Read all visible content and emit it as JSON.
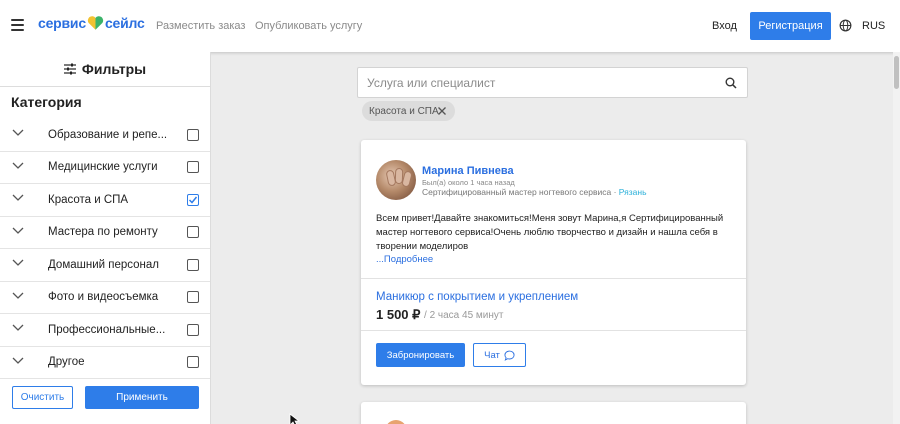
{
  "header": {
    "logo_part1": "сервис",
    "logo_part2": "сейлс",
    "nav": [
      "Разместить заказ",
      "Опубликовать услугу"
    ],
    "login": "Вход",
    "register": "Регистрация",
    "lang": "RUS"
  },
  "sidebar": {
    "title": "Фильтры",
    "category_title": "Категория",
    "items": [
      {
        "label": "Образование и репе...",
        "checked": false
      },
      {
        "label": "Медицинские услуги",
        "checked": false
      },
      {
        "label": "Красота и СПА",
        "checked": true
      },
      {
        "label": "Мастера по ремонту",
        "checked": false
      },
      {
        "label": "Домашний персонал",
        "checked": false
      },
      {
        "label": "Фото и видеосъемка",
        "checked": false
      },
      {
        "label": "Профессиональные...",
        "checked": false
      },
      {
        "label": "Другое",
        "checked": false
      }
    ],
    "clear": "Очистить",
    "apply": "Применить"
  },
  "search": {
    "placeholder": "Услуга или специалист",
    "value": "",
    "chip": "Красота и СПА"
  },
  "card": {
    "name": "Марина Пивнева",
    "seen": "Был(а) около 1 часа назад",
    "role": "Сертифицированный мастер ногтевого сервиса",
    "city": "Рязань",
    "description": "Всем привет!Давайте знакомиться!Меня зовут Марина,я Сертифицированный мастер ногтевого сервиса!Очень люблю творчество и дизайн и нашла себя в творении моделиров",
    "more": "...Подробнее",
    "service": "Маникюр с покрытием и укреплением",
    "price": "1 500 ₽",
    "duration": "2 часа 45 минут",
    "book": "Забронировать",
    "chat": "Чат"
  },
  "colors": {
    "accent": "#2e7de9",
    "link": "#2b6fe0",
    "city": "#2bb0d9",
    "logo_heart_left": "#f2c230",
    "logo_heart_right": "#3bb36a"
  },
  "icons": [
    "menu-icon",
    "heart-logo-icon",
    "globe-icon",
    "filter-sliders-icon",
    "chevron-down-icon",
    "checkbox-check-icon",
    "search-icon",
    "close-icon",
    "chat-bubble-icon"
  ]
}
